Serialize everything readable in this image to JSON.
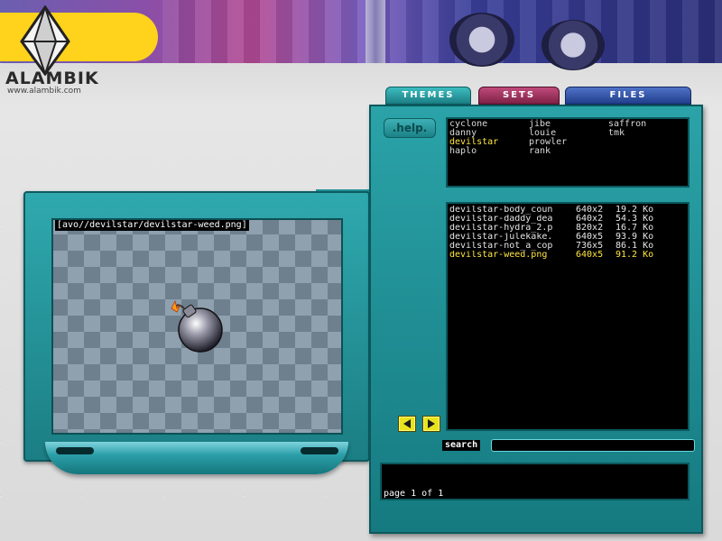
{
  "app": {
    "logo_text": "ALAMBIK",
    "logo_url": "www.alambik.com"
  },
  "tabs": [
    {
      "label": "THEMES",
      "color": "#1b7e84"
    },
    {
      "label": "SETS",
      "color": "#7e2146"
    },
    {
      "label": "FILES",
      "color": "#203e8a"
    }
  ],
  "help_label": ".help.",
  "themes": [
    {
      "name": "cyclone",
      "active": false
    },
    {
      "name": "danny",
      "active": false
    },
    {
      "name": "devilstar",
      "active": true
    },
    {
      "name": "haplo",
      "active": false
    },
    {
      "name": "jibe",
      "active": false
    },
    {
      "name": "louie",
      "active": false
    },
    {
      "name": "prowler",
      "active": false
    },
    {
      "name": "rank",
      "active": false
    },
    {
      "name": "saffron",
      "active": false
    },
    {
      "name": "tmk",
      "active": false
    }
  ],
  "files": [
    {
      "name": "devilstar-body_coun",
      "dims": "640x2",
      "size": "19.2 Ko",
      "active": false
    },
    {
      "name": "devilstar-daddy_dea",
      "dims": "640x2",
      "size": "54.3 Ko",
      "active": false
    },
    {
      "name": "devilstar-hydra_2.p",
      "dims": "820x2",
      "size": "16.7 Ko",
      "active": false
    },
    {
      "name": "devilstar-julekake.",
      "dims": "640x5",
      "size": "93.9 Ko",
      "active": false
    },
    {
      "name": "devilstar-not_a_cop",
      "dims": "736x5",
      "size": "86.1 Ko",
      "active": false
    },
    {
      "name": "devilstar-weed.png",
      "dims": "640x5",
      "size": "91.2 Ko",
      "active": true
    }
  ],
  "preview": {
    "path": "[avo//devilstar/devilstar-weed.png]"
  },
  "search": {
    "label": "search",
    "value": ""
  },
  "status": {
    "page_text": "page 1 of 1"
  },
  "colors": {
    "panel": "#1b8f95",
    "highlight": "#ffe640",
    "logo_yellow": "#ffd21c"
  }
}
